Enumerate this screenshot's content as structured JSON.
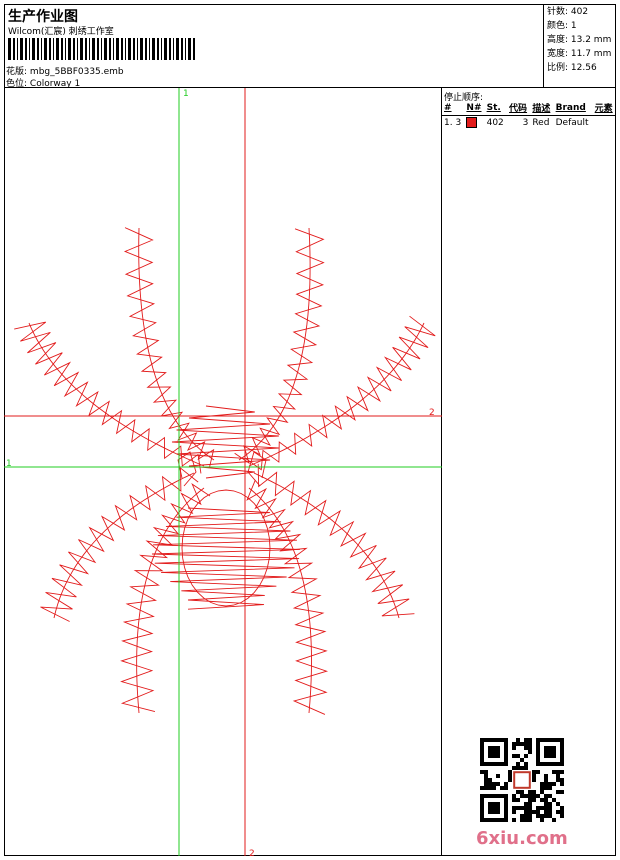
{
  "header": {
    "title": "生产作业图",
    "company": "Wilcom(汇宸) 刺绣工作室",
    "design_label": "花版:",
    "design_file": "mbg_5BBF0335.emb",
    "colorway_label": "色位:",
    "colorway": "Colorway 1"
  },
  "stats": [
    {
      "label": "针数:",
      "value": "402"
    },
    {
      "label": "颜色:",
      "value": "1"
    },
    {
      "label": "高度:",
      "value": "13.2 mm"
    },
    {
      "label": "宽度:",
      "value": "11.7 mm"
    },
    {
      "label": "比例:",
      "value": "12.56"
    }
  ],
  "stop_sequence": {
    "title": "停止顺序:",
    "columns": [
      "#",
      "N#",
      "St.",
      "代码",
      "描述",
      "Brand",
      "元素"
    ],
    "rows": [
      {
        "index": "1.",
        "n": "3",
        "color": "#e21b1b",
        "stitches": "402",
        "code": "3",
        "desc": "Red",
        "brand": "Default"
      }
    ]
  },
  "guides": {
    "v1": "1",
    "v2": "2",
    "h1": "1",
    "h2": "2"
  },
  "colors": {
    "stitch": "#e21b1b",
    "guide_green": "#22cc22",
    "guide_red": "#e21b1b",
    "watermark": "#e0708a"
  },
  "watermark": {
    "text": "6xiu.com"
  }
}
